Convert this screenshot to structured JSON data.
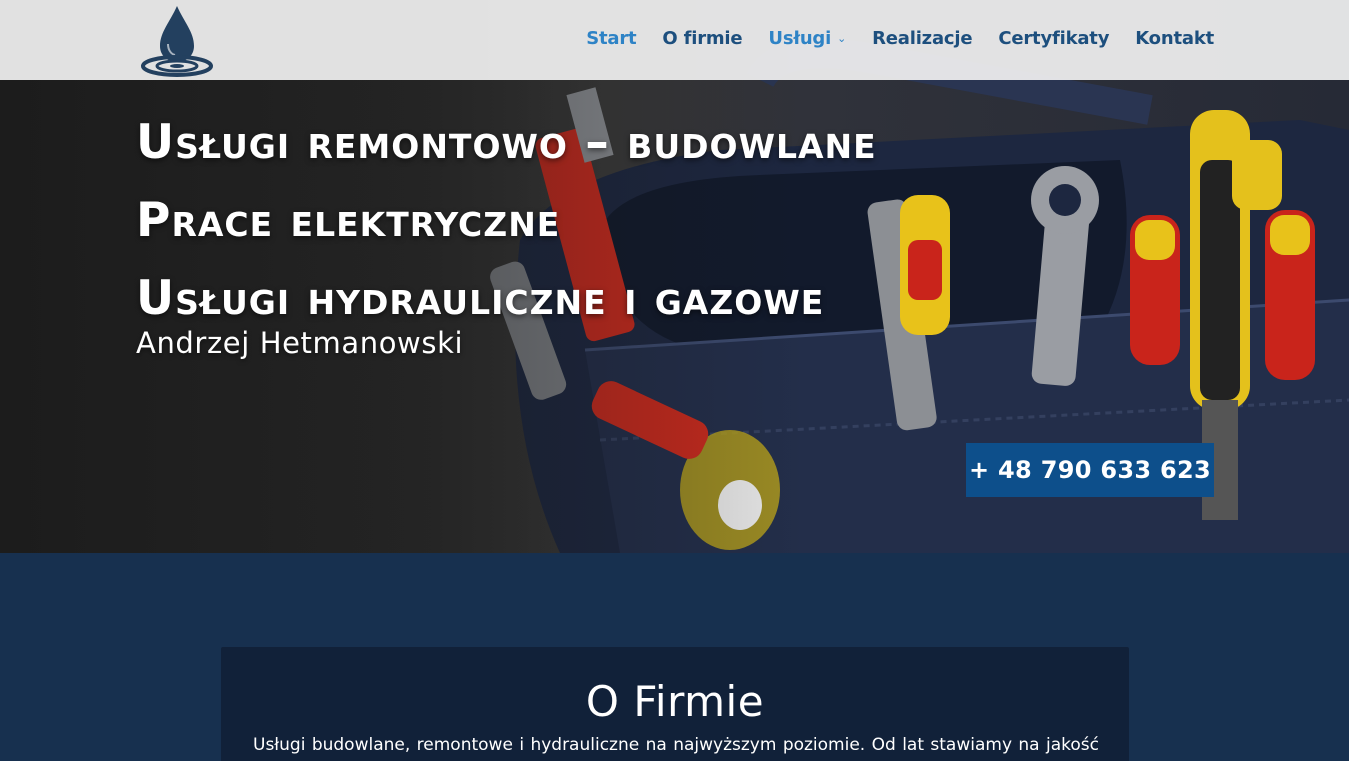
{
  "colors": {
    "nav_text": "#1d4f7e",
    "nav_active": "#2e83c6",
    "button_bg": "#0d4f8b",
    "section_bg": "#17304f",
    "card_bg": "#112139"
  },
  "header": {
    "logo_icon": "water-drop-icon",
    "nav": [
      {
        "label": "Start"
      },
      {
        "label": "O firmie"
      },
      {
        "label": "Usługi"
      },
      {
        "label": "Realizacje"
      },
      {
        "label": "Certyfikaty"
      },
      {
        "label": "Kontakt"
      }
    ]
  },
  "hero": {
    "lines": [
      "Usługi remontowo – budowlane",
      "Prace elektryczne",
      "Usługi hydrauliczne i gazowe"
    ],
    "subtitle": "Andrzej Hetmanowski",
    "phone": "+ 48 790 633 623"
  },
  "about": {
    "title": "O Firmie",
    "text": "Usługi budowlane, remontowe i hydrauliczne na najwyższym poziomie. Od lat stawiamy na jakość"
  }
}
